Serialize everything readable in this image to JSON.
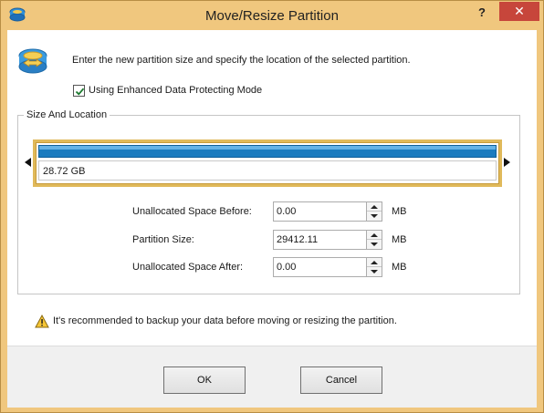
{
  "window": {
    "title": "Move/Resize Partition",
    "help_label": "?",
    "close_label": "✕"
  },
  "dialog": {
    "description": "Enter the new partition size and specify the location of the selected partition.",
    "checkbox": {
      "label": "Using Enhanced Data Protecting Mode",
      "checked": true
    }
  },
  "size_location": {
    "title": "Size And Location",
    "partition_size_label": "28.72 GB",
    "fields": [
      {
        "label": "Unallocated Space Before:",
        "value": "0.00",
        "unit": "MB"
      },
      {
        "label": "Partition Size:",
        "value": "29412.11",
        "unit": "MB"
      },
      {
        "label": "Unallocated Space After:",
        "value": "0.00",
        "unit": "MB"
      }
    ]
  },
  "warning": {
    "text": "It's recommended to backup your data before moving or resizing the partition."
  },
  "buttons": {
    "ok": "OK",
    "cancel": "Cancel"
  },
  "colors": {
    "title_bar": "#f0c77e",
    "close_button": "#c7463b",
    "partition_bar": "#1b7bbf",
    "partition_frame": "#e0b95a"
  },
  "icons": {
    "app": "partition-app-icon",
    "dialog": "move-resize-icon",
    "warning": "warning-icon"
  }
}
